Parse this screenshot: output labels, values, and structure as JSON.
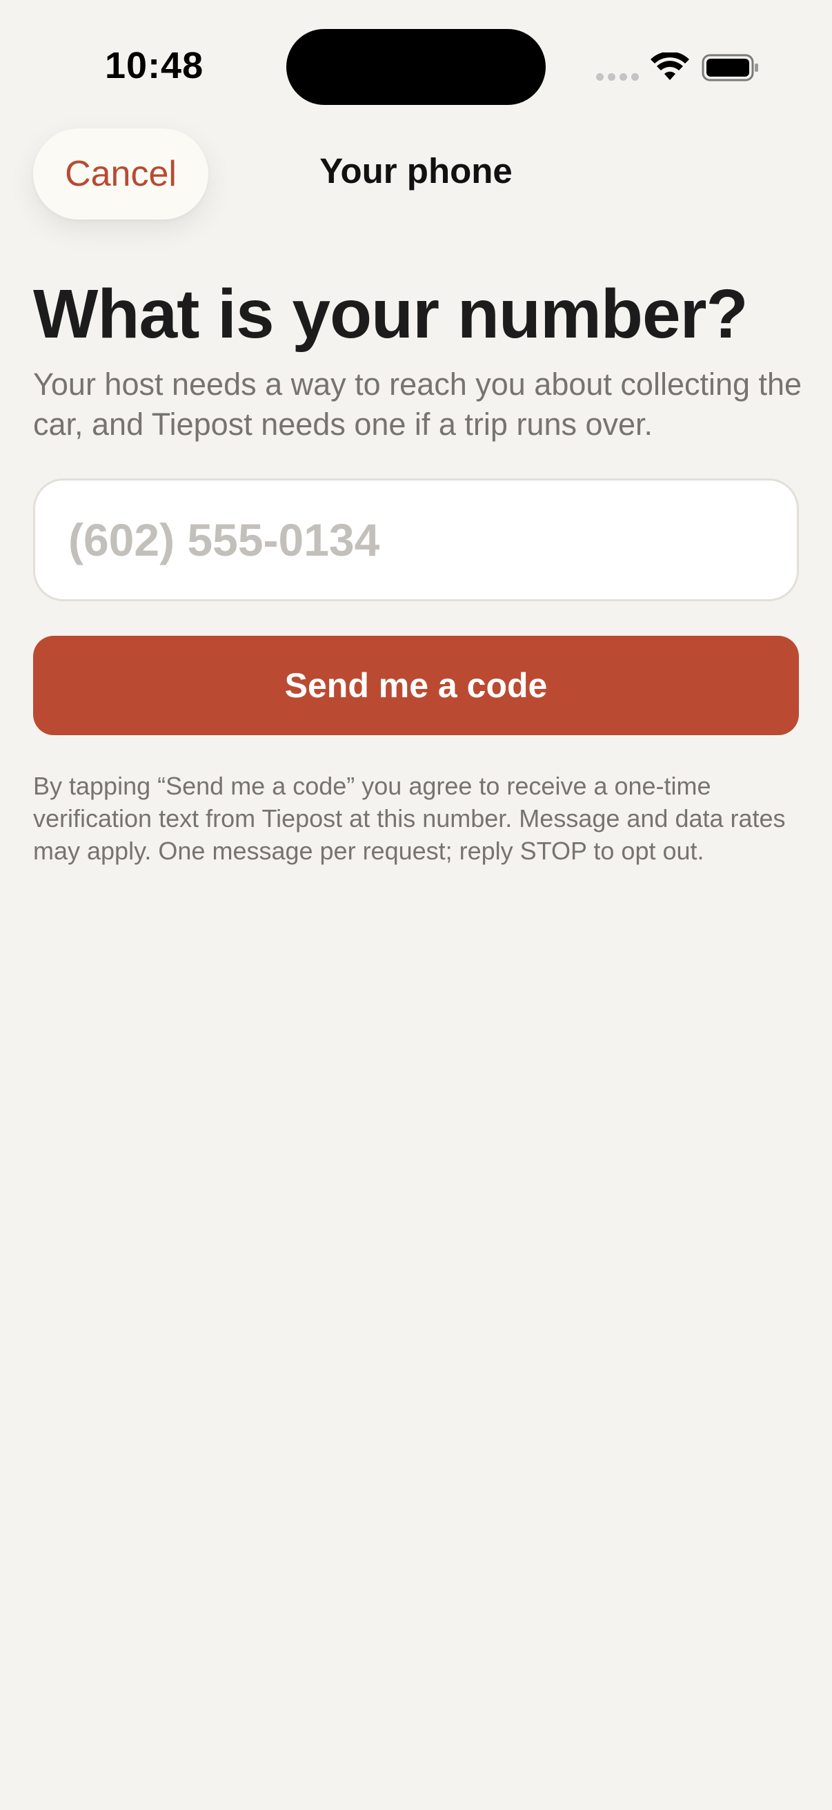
{
  "status_bar": {
    "time": "10:48"
  },
  "nav": {
    "cancel_label": "Cancel",
    "title": "Your phone"
  },
  "content": {
    "headline": "What is your number?",
    "subhead": "Your host needs a way to reach you about collecting the car, and Tiepost needs one if a trip runs over.",
    "phone_placeholder": "(602) 555-0134",
    "phone_value": "",
    "send_label": "Send me a code",
    "disclaimer": "By tapping “Send me a code” you agree to receive a one-time verification text from Tiepost at this number. Message and data rates may apply. One message per request; reply STOP to opt out."
  },
  "colors": {
    "background": "#f5f3ef",
    "accent": "#bb4a32",
    "muted_text": "#77746f"
  },
  "icons": [
    "signal-icon",
    "wifi-icon",
    "battery-icon"
  ]
}
